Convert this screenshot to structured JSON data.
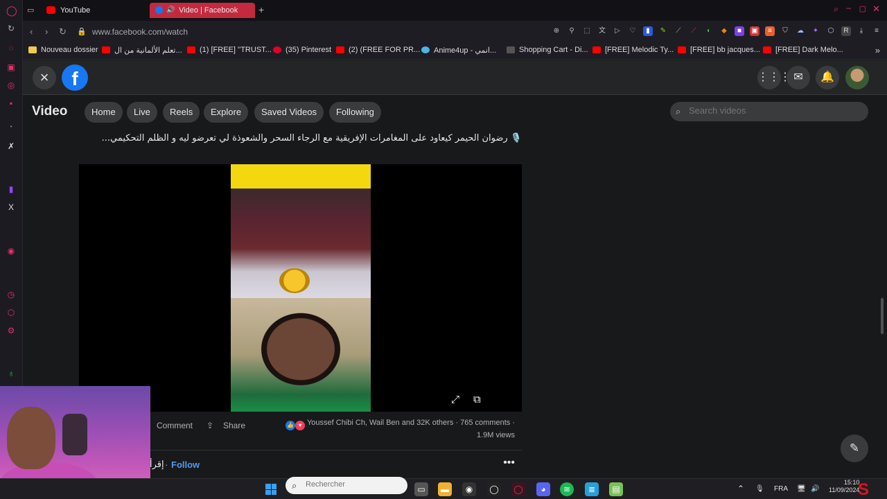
{
  "browser": {
    "tabs": [
      {
        "label": "YouTube",
        "color": "#ff0000"
      },
      {
        "label": "Video | Facebook",
        "color": "#1877f2"
      }
    ],
    "url": "www.facebook.com/watch",
    "bookmarks": [
      {
        "label": "Nouveau dossier",
        "color": "#f2c94c"
      },
      {
        "label": "تعلم الألمانية من ال...",
        "color": "#ff0000"
      },
      {
        "label": "(1) [FREE] ''TRUST...",
        "color": "#ff0000"
      },
      {
        "label": "(35) Pinterest",
        "color": "#e60023"
      },
      {
        "label": "(2) (FREE FOR PR...",
        "color": "#ff0000"
      },
      {
        "label": "Anime4up - انمي...",
        "color": "#4ab6e8"
      },
      {
        "label": "Shopping Cart - Di...",
        "color": "#555555"
      },
      {
        "label": "[FREE] Melodic Ty...",
        "color": "#ff0000"
      },
      {
        "label": "[FREE] bb jacques...",
        "color": "#ff0000"
      },
      {
        "label": "[FREE] Dark Melo...",
        "color": "#ff0000"
      }
    ]
  },
  "facebook": {
    "close_icon": "×",
    "logo_letter": "f",
    "section_title": "Video",
    "nav": [
      "Home",
      "Live",
      "Reels",
      "Explore",
      "Saved Videos",
      "Following"
    ],
    "search_placeholder": "Search videos",
    "post": {
      "caption": "🎙️ رضوان الحيمر كيعاود على المغامرات الإفريقية مع الرجاء السحر والشعوذة لي تعرضو ليه و الظلم التحكيمي...",
      "comment_label": "Comment",
      "share_label": "Share",
      "reactions_text": "Youssef Chibi Ch, Wail Ben and 32K others",
      "comments_count": "765 comments",
      "views": "1.9M views",
      "author_partial": "إقرأ",
      "follow_label": "Follow"
    }
  },
  "taskbar": {
    "search_placeholder": "Rechercher",
    "language": "FRA",
    "time": "15:10",
    "date": "11/09/2024"
  }
}
